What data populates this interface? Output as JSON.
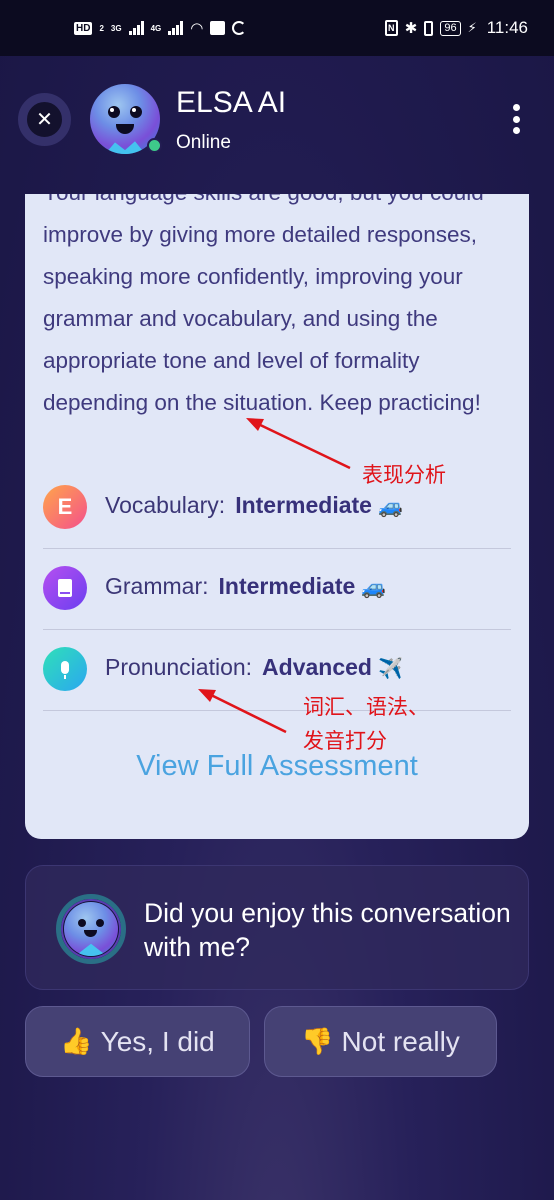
{
  "status_bar": {
    "left_indicators": [
      "HD",
      "2",
      "3G",
      "4G",
      "wifi",
      "gallery",
      "sync"
    ],
    "network_3g": "3G",
    "network_4g": "4G",
    "hd_label": "HD",
    "sim_label": "2",
    "battery": "96",
    "time": "11:46"
  },
  "header": {
    "close_icon": "close-icon",
    "title": "ELSA AI",
    "status": "Online",
    "more_icon": "more-vertical-icon"
  },
  "assessment": {
    "feedback_text": "Your language skills are good, but you could improve by giving more detailed responses, speaking more confidently, improving your grammar and vocabulary, and using the appropriate tone and level of formality depending on the situation. Keep practicing!",
    "skills": [
      {
        "label": "Vocabulary:",
        "level": "Intermediate",
        "icon": "letter-e-icon",
        "icon_text": "E",
        "emoji": "🚙"
      },
      {
        "label": "Grammar:",
        "level": "Intermediate",
        "icon": "book-icon",
        "emoji": "🚙"
      },
      {
        "label": "Pronunciation:",
        "level": "Advanced",
        "icon": "microphone-icon",
        "emoji": "✈️"
      }
    ],
    "view_full_label": "View Full Assessment"
  },
  "annotations": {
    "performance_analysis": "表现分析",
    "scoring_line1": "词汇、语法、",
    "scoring_line2": "发音打分",
    "color": "#e0141a"
  },
  "feedback_prompt": {
    "question": "Did you enjoy this conversation with me?",
    "yes_emoji": "👍",
    "yes_label": "Yes, I did",
    "no_emoji": "👎",
    "no_label": "Not really"
  },
  "colors": {
    "background": "#221d50",
    "card": "#e1e7f7",
    "text_primary": "#3b3676",
    "link": "#4aa3e0",
    "online": "#3ec98a"
  }
}
